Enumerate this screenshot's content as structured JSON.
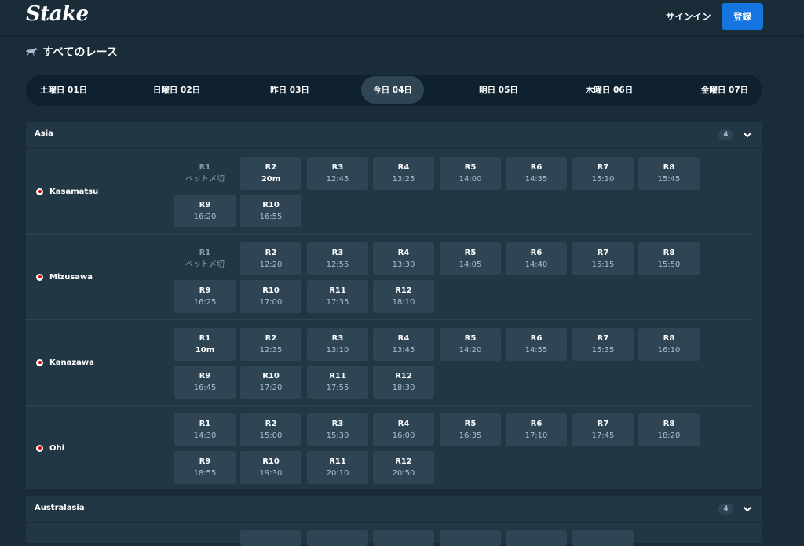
{
  "header": {
    "logo": "Stake",
    "signin_label": "サインイン",
    "register_label": "登録"
  },
  "page": {
    "title": "すべてのレース",
    "icon": "horse-icon"
  },
  "day_tabs": [
    {
      "label": "土曜日 01日"
    },
    {
      "label": "日曜日 02日"
    },
    {
      "label": "昨日 03日"
    },
    {
      "label": "今日 04日",
      "active": true
    },
    {
      "label": "明日 05日"
    },
    {
      "label": "木曜日 06日"
    },
    {
      "label": "金曜日 07日"
    }
  ],
  "regions": [
    {
      "name": "Asia",
      "count": "4",
      "tracks": [
        {
          "name": "Kasamatsu",
          "races": [
            {
              "num": "R1",
              "time": "ベット〆切",
              "closed": true
            },
            {
              "num": "R2",
              "time": "20m",
              "soon": true
            },
            {
              "num": "R3",
              "time": "12:45"
            },
            {
              "num": "R4",
              "time": "13:25"
            },
            {
              "num": "R5",
              "time": "14:00"
            },
            {
              "num": "R6",
              "time": "14:35"
            },
            {
              "num": "R7",
              "time": "15:10"
            },
            {
              "num": "R8",
              "time": "15:45"
            },
            {
              "num": "R9",
              "time": "16:20"
            },
            {
              "num": "R10",
              "time": "16:55"
            }
          ]
        },
        {
          "name": "Mizusawa",
          "races": [
            {
              "num": "R1",
              "time": "ベット〆切",
              "closed": true
            },
            {
              "num": "R2",
              "time": "12:20"
            },
            {
              "num": "R3",
              "time": "12:55"
            },
            {
              "num": "R4",
              "time": "13:30"
            },
            {
              "num": "R5",
              "time": "14:05"
            },
            {
              "num": "R6",
              "time": "14:40"
            },
            {
              "num": "R7",
              "time": "15:15"
            },
            {
              "num": "R8",
              "time": "15:50"
            },
            {
              "num": "R9",
              "time": "16:25"
            },
            {
              "num": "R10",
              "time": "17:00"
            },
            {
              "num": "R11",
              "time": "17:35"
            },
            {
              "num": "R12",
              "time": "18:10"
            }
          ]
        },
        {
          "name": "Kanazawa",
          "races": [
            {
              "num": "R1",
              "time": "10m",
              "soon": true
            },
            {
              "num": "R2",
              "time": "12:35"
            },
            {
              "num": "R3",
              "time": "13:10"
            },
            {
              "num": "R4",
              "time": "13:45"
            },
            {
              "num": "R5",
              "time": "14:20"
            },
            {
              "num": "R6",
              "time": "14:55"
            },
            {
              "num": "R7",
              "time": "15:35"
            },
            {
              "num": "R8",
              "time": "16:10"
            },
            {
              "num": "R9",
              "time": "16:45"
            },
            {
              "num": "R10",
              "time": "17:20"
            },
            {
              "num": "R11",
              "time": "17:55"
            },
            {
              "num": "R12",
              "time": "18:30"
            }
          ]
        },
        {
          "name": "Ohi",
          "races": [
            {
              "num": "R1",
              "time": "14:30"
            },
            {
              "num": "R2",
              "time": "15:00"
            },
            {
              "num": "R3",
              "time": "15:30"
            },
            {
              "num": "R4",
              "time": "16:00"
            },
            {
              "num": "R5",
              "time": "16:35"
            },
            {
              "num": "R6",
              "time": "17:10"
            },
            {
              "num": "R7",
              "time": "17:45"
            },
            {
              "num": "R8",
              "time": "18:20"
            },
            {
              "num": "R9",
              "time": "18:55"
            },
            {
              "num": "R10",
              "time": "19:30"
            },
            {
              "num": "R11",
              "time": "20:10"
            },
            {
              "num": "R12",
              "time": "20:50"
            }
          ]
        }
      ]
    },
    {
      "name": "Australasia",
      "count": "4",
      "tracks": []
    }
  ],
  "colors": {
    "bg": "#1a2c38",
    "panel": "#213743",
    "button": "#2f4553",
    "accent": "#1475e1",
    "muted_text": "#b1bad3"
  }
}
